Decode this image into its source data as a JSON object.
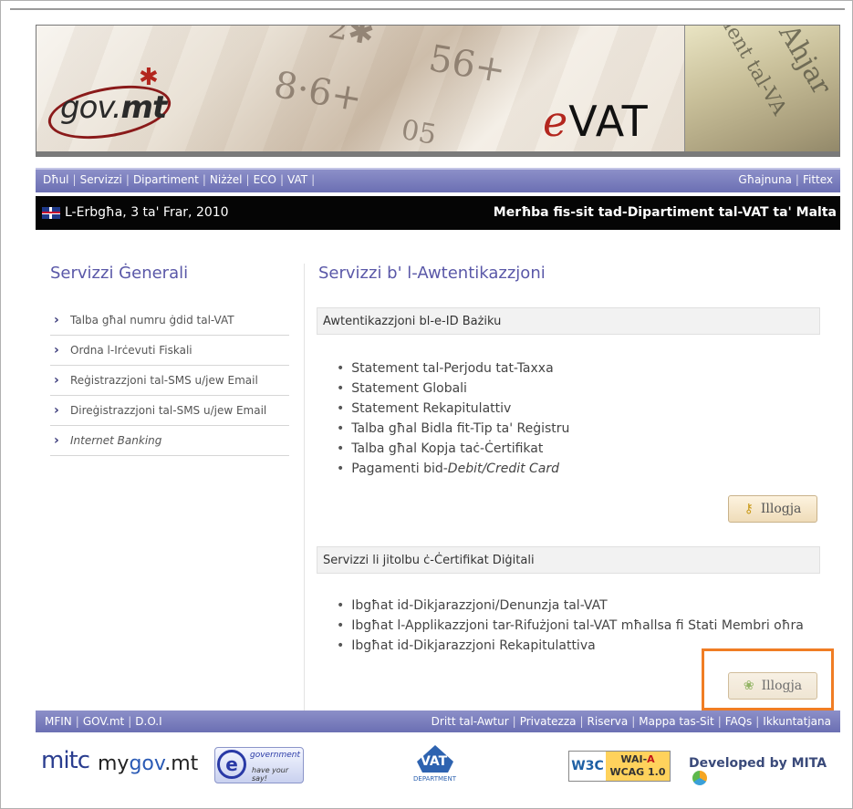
{
  "banner": {
    "logo_text": "gov.mt",
    "logo_prefix": "gov.",
    "logo_suffix": "mt",
    "title_e": "e",
    "title_rest": "VAT"
  },
  "nav": {
    "left_links": [
      "Dħul",
      "Servizzi",
      "Dipartiment",
      "Niżżel",
      "ECO",
      "VAT"
    ],
    "right_links": [
      "Għajnuna",
      "Fittex"
    ]
  },
  "datebar": {
    "date": "L-Erbgħa, 3 ta' Frar, 2010",
    "welcome": "Merħba fis-sit tad-Dipartiment tal-VAT ta' Malta"
  },
  "left": {
    "title": "Servizzi Ġenerali",
    "items": [
      "Talba għal numru ġdid tal-VAT",
      "Ordna l-Irċevuti Fiskali",
      "Reġistrazzjoni tal-SMS u/jew Email",
      "Direġistrazzjoni tal-SMS u/jew Email",
      "Internet Banking"
    ]
  },
  "right": {
    "title": "Servizzi b' l-Awtentikazzjoni",
    "section1": {
      "heading": "Awtentikazzjoni bl-e-ID Bażiku",
      "items": [
        "Statement tal-Perjodu tat-Taxxa",
        "Statement Globali",
        "Statement Rekapitulattiv",
        "Talba għal Bidla fit-Tip ta' Reġistru",
        "Talba għal Kopja taċ-Ċertifikat"
      ],
      "last_item_prefix": "Pagamenti bid-",
      "last_item_italic": "Debit/Credit Card",
      "button": "Illogja"
    },
    "section2": {
      "heading": "Servizzi li jitolbu ċ-Ċertifikat Diġitali",
      "items": [
        "Ibgħat id-Dikjarazzjoni/Denunzja tal-VAT",
        "Ibgħat l-Applikazzjoni tar-Rifużjoni tal-VAT mħallsa fi Stati Membri oħra",
        "Ibgħat id-Dikjarazzjoni Rekapitulattiva"
      ],
      "button": "Illogja"
    }
  },
  "footer": {
    "left_links": [
      "MFIN",
      "GOV.mt",
      "D.O.I"
    ],
    "right_links": [
      "Dritt tal-Awtur",
      "Privatezza",
      "Riserva",
      "Mappa tas-Sit",
      "FAQs",
      "Ikkuntatjana"
    ],
    "logos": {
      "mitc": "mitc",
      "mygov_my": "my",
      "mygov_gov": "gov",
      "mygov_mt": ".mt",
      "egov_line1": "government",
      "egov_line2": "have your say!",
      "vat_label": "VAT",
      "vat_dept": "DEPARTMENT",
      "w3c": "W3C",
      "wai_a1": "WAI-",
      "wai_a2": "A",
      "wcag": "WCAG 1.0",
      "developed": "Developed by MITA"
    }
  },
  "colors": {
    "nav_bar": "#6b6fb3",
    "title_purple": "#5a58a8",
    "highlight": "#f07d24"
  }
}
